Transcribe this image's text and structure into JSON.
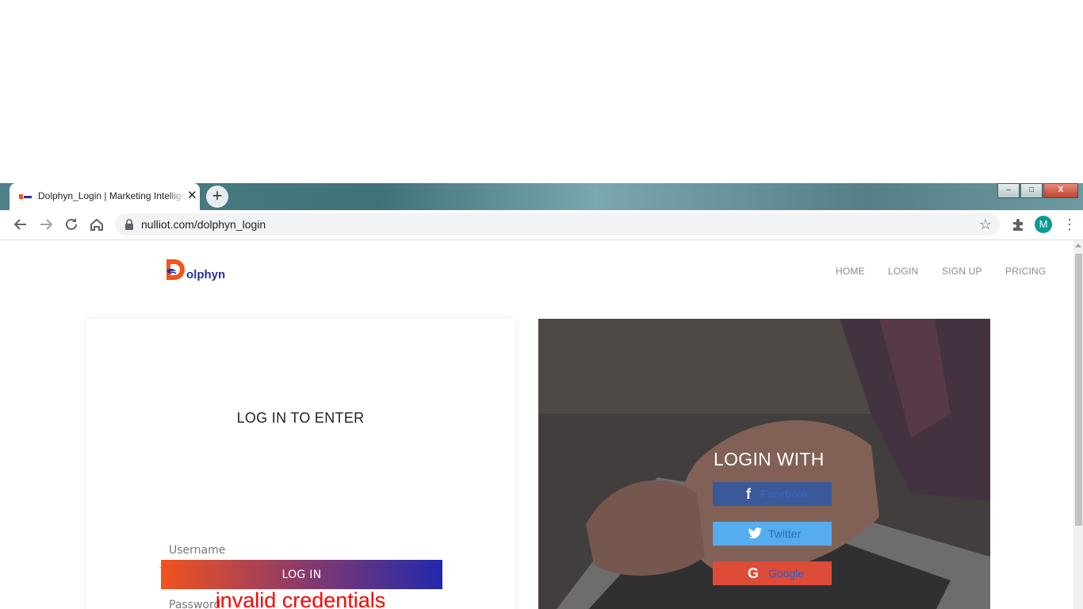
{
  "browser": {
    "tab_title": "Dolphyn_Login | Marketing Intelligence",
    "tab_close": "✕",
    "new_tab": "+",
    "url": "nulliot.com/dolphyn_login",
    "avatar_initial": "M",
    "window_controls": {
      "minimize": "–",
      "maximize": "□",
      "close": "X"
    }
  },
  "page": {
    "logo": {
      "letter": "D",
      "text": "olphyn"
    },
    "nav": [
      {
        "label": "HOME"
      },
      {
        "label": "LOGIN"
      },
      {
        "label": "SIGN UP"
      },
      {
        "label": "PRICING"
      }
    ],
    "login_card": {
      "title": "LOG IN TO ENTER",
      "username_placeholder": "Username",
      "password_placeholder": "Password",
      "submit_label": "LOG IN",
      "error_message": "invalid credentials"
    },
    "social": {
      "title": "LOGIN WITH",
      "buttons": [
        {
          "label": "Facebook",
          "icon": "facebook-icon",
          "glyph": "f"
        },
        {
          "label": "Twitter",
          "icon": "twitter-icon",
          "glyph": ""
        },
        {
          "label": "Google",
          "icon": "google-icon",
          "glyph": "G"
        }
      ]
    },
    "colors": {
      "brand_orange": "#f2531f",
      "brand_blue": "#27329a",
      "error": "#ff0000",
      "facebook": "#3b5998",
      "twitter": "#55acee",
      "google": "#dd4b39"
    }
  }
}
